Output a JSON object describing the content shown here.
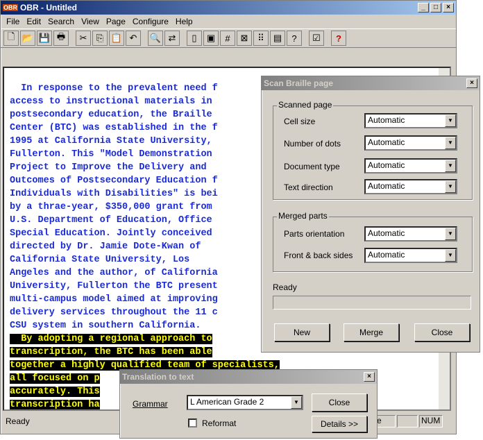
{
  "main": {
    "title": "OBR - Untitled",
    "title_icon": "OBR",
    "menu": [
      "File",
      "Edit",
      "Search",
      "View",
      "Page",
      "Configure",
      "Help"
    ],
    "toolbar_icons": [
      "new-icon",
      "open-icon",
      "save-icon",
      "print-icon",
      "cut-icon",
      "copy-icon",
      "paste-icon",
      "undo-icon",
      "find-icon",
      "replace-icon",
      "page-icon",
      "page2-icon",
      "grid-icon",
      "cross-icon",
      "braille-icon",
      "table-icon",
      "abc-icon",
      "properties-icon",
      "help-icon"
    ],
    "document_lines": [
      "  In response to the prevalent need f",
      "access to instructional materials in",
      "postsecondary education, the Braille",
      "Center (BTC) was established in the f",
      "1995 at California State University,",
      "Fullerton. This \"Model Demonstration",
      "Project to Improve the Delivery and",
      "Outcomes of Postsecondary Education f",
      "Individuals with Disabilities\" is bei",
      "by a thrae-year, $350,000 grant from",
      "U.S. Department of Education, Office",
      "Special Education. Jointly conceived",
      "directed by Dr. Jamie Dote-Kwan of",
      "California State University, Los",
      "Angeles and the author, of California",
      "University, Fullerton the BTC present",
      "multi-campus model aimed at improving",
      "delivery services throughout the 11 c",
      "CSU system in southern California."
    ],
    "highlighted_lines": [
      "  By adopting a regional approach to",
      "transcription, the BTC has been able",
      "together a highly qualified team of specialists,",
      "all focused on p",
      "accurately. This",
      "transcription ha"
    ],
    "status": "Ready",
    "status_num": "NUM",
    "status_e": "e"
  },
  "scan": {
    "title": "Scan Braille page",
    "group1": "Scanned page",
    "rows1": [
      {
        "label": "Cell size",
        "value": "Automatic"
      },
      {
        "label": "Number of dots",
        "value": "Automatic"
      },
      {
        "label": "Document type",
        "value": "Automatic"
      },
      {
        "label": "Text direction",
        "value": "Automatic"
      }
    ],
    "group2": "Merged parts",
    "rows2": [
      {
        "label": "Parts orientation",
        "value": "Automatic"
      },
      {
        "label": "Front & back sides",
        "value": "Automatic"
      }
    ],
    "ready": "Ready",
    "new_label": "New",
    "merge_label": "Merge",
    "close_label": "Close"
  },
  "trans": {
    "title": "Translation to text",
    "grammar_label": "Grammar",
    "grammar_value": "L American Grade 2",
    "close_label": "Close",
    "reformat_label": "Reformat",
    "details_label": "Details >>"
  }
}
